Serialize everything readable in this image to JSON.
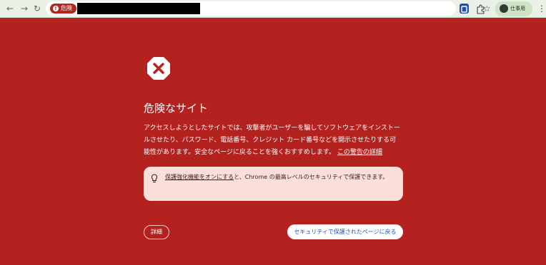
{
  "browser": {
    "back_glyph": "←",
    "forward_glyph": "→",
    "reload_glyph": "↻",
    "danger_chip_label": "危険",
    "star_glyph": "☆",
    "profile_label": "仕事用",
    "menu_glyph": "⋮",
    "icons": [
      "back-arrow-icon",
      "forward-arrow-icon",
      "reload-icon",
      "danger-icon",
      "bookmark-star-icon",
      "extension-icon",
      "puzzle-icon",
      "avatar",
      "kebab-menu-icon"
    ]
  },
  "interstitial": {
    "icon": "warning-octagon-icon",
    "title": "危険なサイト",
    "body_line_1": "アクセスしようとしたサイトでは、攻撃者がユーザーを騙してソフトウェアをインストー",
    "body_line_2": "ルさせたり、パスワード、電話番号、クレジット カード番号などを開示させたりする可",
    "body_line_3": "能性があります。安全なページに戻ることを強くおすすめします。",
    "warning_details_link": "この警告の詳細",
    "promo_link": "保護強化機能をオンにする",
    "promo_text": "と、Chrome の最高レベルのセキュリティで保護できます。",
    "details_button": "詳細",
    "back_to_safety_button": "セキュリティで保護されたページに戻る"
  },
  "colors": {
    "page_background": "#b3221f",
    "toolbar_background": "#eaf1e6",
    "promo_background": "#fbdfdb",
    "link_blue": "#1a57c9"
  }
}
